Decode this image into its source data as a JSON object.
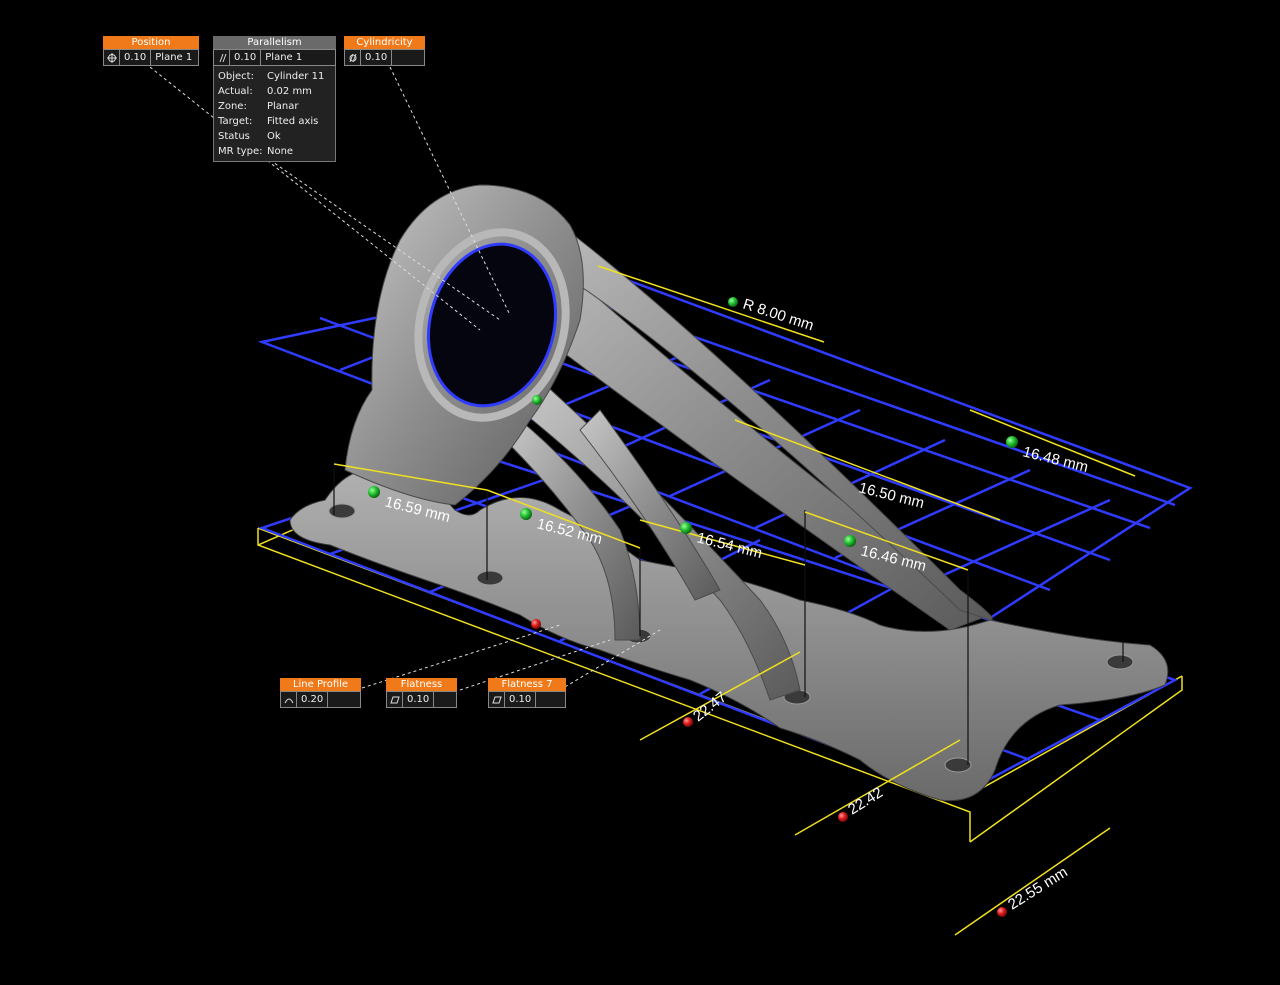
{
  "callouts": {
    "position": {
      "title": "Position",
      "tolerance": "0.10",
      "datum": "Plane 1",
      "symbol": "position-icon"
    },
    "parallelism": {
      "title": "Parallelism",
      "tolerance": "0.10",
      "datum": "Plane 1",
      "symbol": "parallelism-icon",
      "details": [
        {
          "key": "Object:",
          "value": "Cylinder 11"
        },
        {
          "key": "Actual:",
          "value": "0.02 mm"
        },
        {
          "key": "Zone:",
          "value": "Planar"
        },
        {
          "key": "Target:",
          "value": "Fitted axis"
        },
        {
          "key": "Status",
          "value": "Ok"
        },
        {
          "key": "MR type:",
          "value": "None"
        }
      ]
    },
    "cylindricity": {
      "title": "Cylindricity",
      "tolerance": "0.10",
      "symbol": "cylindricity-icon"
    },
    "line_profile": {
      "title": "Line Profile",
      "tolerance": "0.20",
      "symbol": "line-profile-icon"
    },
    "flatness": {
      "title": "Flatness",
      "tolerance": "0.10",
      "symbol": "flatness-icon"
    },
    "flatness7": {
      "title": "Flatness 7",
      "tolerance": "0.10",
      "symbol": "flatness-icon"
    }
  },
  "measurements": {
    "radius": "R 8.00 mm",
    "d1": "16.59 mm",
    "d2": "16.52 mm",
    "d3": "16.54 mm",
    "d4": "16.46 mm",
    "d5": "16.50 mm",
    "d6": "16.48 mm",
    "w1": "22.47",
    "w2": "22.42",
    "w3": "22.55 mm"
  },
  "colors": {
    "callout_header": "#f07a1a",
    "grid": "#2f3cff",
    "dimension": "#f0e020",
    "ok_marker": "#1fbf2f",
    "fail_marker": "#e01818",
    "part": "#8a8a8a"
  }
}
